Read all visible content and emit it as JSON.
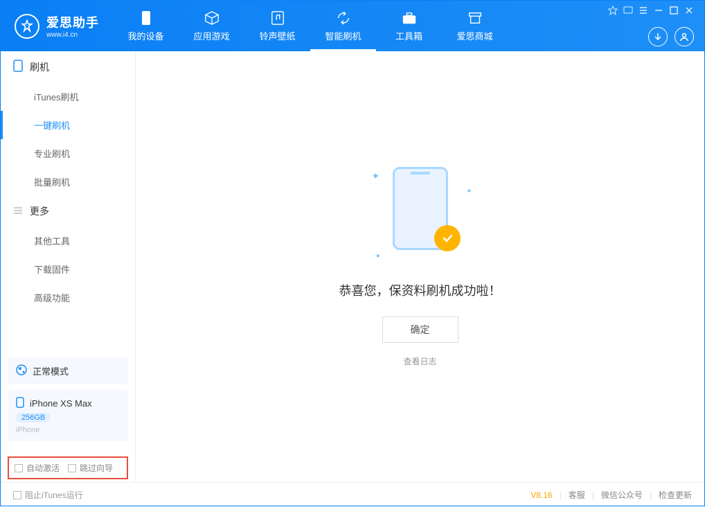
{
  "app": {
    "title": "爱思助手",
    "subtitle": "www.i4.cn"
  },
  "tabs": [
    {
      "label": "我的设备"
    },
    {
      "label": "应用游戏"
    },
    {
      "label": "铃声壁纸"
    },
    {
      "label": "智能刷机"
    },
    {
      "label": "工具箱"
    },
    {
      "label": "爱思商城"
    }
  ],
  "sidebar": {
    "section1": {
      "title": "刷机"
    },
    "items1": [
      {
        "label": "iTunes刷机"
      },
      {
        "label": "一键刷机"
      },
      {
        "label": "专业刷机"
      },
      {
        "label": "批量刷机"
      }
    ],
    "section2": {
      "title": "更多"
    },
    "items2": [
      {
        "label": "其他工具"
      },
      {
        "label": "下载固件"
      },
      {
        "label": "高级功能"
      }
    ]
  },
  "mode_card": {
    "label": "正常模式"
  },
  "device_card": {
    "name": "iPhone XS Max",
    "capacity": "256GB",
    "type": "iPhone"
  },
  "options": {
    "auto_activate": "自动激活",
    "skip_guide": "跳过向导"
  },
  "main": {
    "success_message": "恭喜您，保资料刷机成功啦！",
    "ok_button": "确定",
    "view_log": "查看日志"
  },
  "footer": {
    "block_itunes": "阻止iTunes运行",
    "version": "V8.16",
    "support": "客服",
    "wechat": "微信公众号",
    "update": "检查更新"
  }
}
